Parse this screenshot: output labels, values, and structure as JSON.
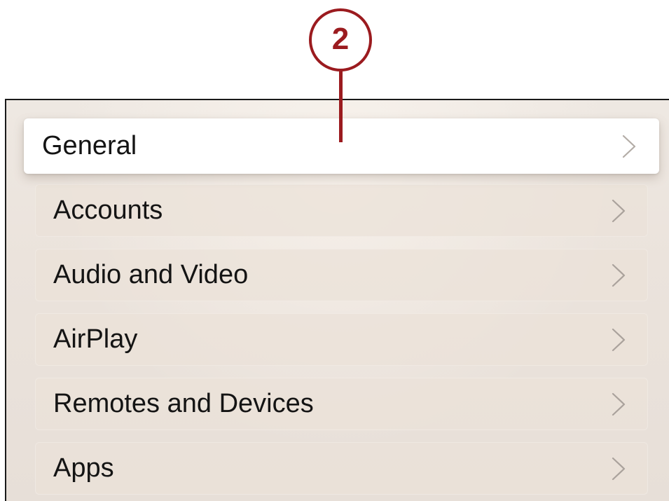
{
  "callout": {
    "number": "2",
    "color": "#9b1b1f"
  },
  "settings_menu": {
    "items": [
      {
        "label": "General",
        "icon": "chevron-right-icon",
        "focused": true
      },
      {
        "label": "Accounts",
        "icon": "chevron-right-icon",
        "focused": false
      },
      {
        "label": "Audio and Video",
        "icon": "chevron-right-icon",
        "focused": false
      },
      {
        "label": "AirPlay",
        "icon": "chevron-right-icon",
        "focused": false
      },
      {
        "label": "Remotes and Devices",
        "icon": "chevron-right-icon",
        "focused": false
      },
      {
        "label": "Apps",
        "icon": "chevron-right-icon",
        "focused": false
      }
    ]
  }
}
